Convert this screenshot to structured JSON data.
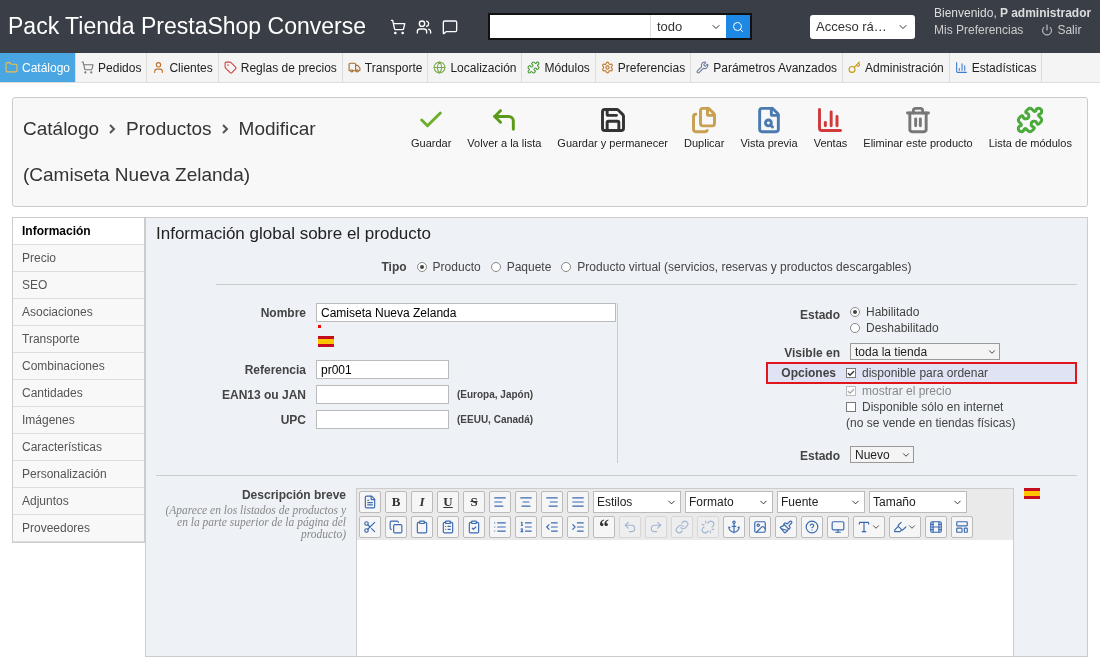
{
  "header": {
    "title": "Pack Tienda PrestaShop Converse",
    "search": {
      "scope": "todo"
    },
    "quick_access": "Acceso rá…",
    "welcome": "Bienvenido, **P administrador**",
    "preferences_link": "Mis Preferencias",
    "logout": "Salir"
  },
  "nav": [
    {
      "label": "Catálogo",
      "selected": true
    },
    {
      "label": "Pedidos",
      "selected": false
    },
    {
      "label": "Clientes",
      "selected": false
    },
    {
      "label": "Reglas de precios",
      "selected": false
    },
    {
      "label": "Transporte",
      "selected": false
    },
    {
      "label": "Localización",
      "selected": false
    },
    {
      "label": "Módulos",
      "selected": false
    },
    {
      "label": "Preferencias",
      "selected": false
    },
    {
      "label": "Parámetros Avanzados",
      "selected": false
    },
    {
      "label": "Administración",
      "selected": false
    },
    {
      "label": "Estadísticas",
      "selected": false
    }
  ],
  "breadcrumb": [
    "Catálogo",
    "Productos",
    "Modificar"
  ],
  "page_subtitle": "(Camiseta Nueva Zelanda)",
  "actions": [
    "Guardar",
    "Volver a la lista",
    "Guardar y permanecer",
    "Duplicar",
    "Vista previa",
    "Ventas",
    "Eliminar este producto",
    "Lista de módulos"
  ],
  "side_tabs": [
    {
      "label": "Información",
      "selected": true
    },
    {
      "label": "Precio",
      "selected": false
    },
    {
      "label": "SEO",
      "selected": false
    },
    {
      "label": "Asociaciones",
      "selected": false
    },
    {
      "label": "Transporte",
      "selected": false
    },
    {
      "label": "Combinaciones",
      "selected": false
    },
    {
      "label": "Cantidades",
      "selected": false
    },
    {
      "label": "Imágenes",
      "selected": false
    },
    {
      "label": "Características",
      "selected": false
    },
    {
      "label": "Personalización",
      "selected": false
    },
    {
      "label": "Adjuntos",
      "selected": false
    },
    {
      "label": "Proveedores",
      "selected": false
    }
  ],
  "panel_title": "Información global sobre el producto",
  "type": {
    "label": "Tipo",
    "options": [
      {
        "label": "Producto",
        "selected": true
      },
      {
        "label": "Paquete",
        "selected": false
      },
      {
        "label": "Producto virtual (servicios, reservas y productos descargables)",
        "selected": false
      }
    ]
  },
  "fields": [
    {
      "label": "Nombre",
      "value": "Camiseta Nueva Zelanda",
      "kind": "wide",
      "required": true,
      "flag": true
    },
    {
      "label": "Referencia",
      "value": "pr001",
      "kind": "short"
    },
    {
      "label": "EAN13 ou JAN",
      "kind": "short",
      "note": "(Europa, Japón)"
    },
    {
      "label": "UPC",
      "kind": "short",
      "note": "(EEUU, Canadá)"
    }
  ],
  "status": {
    "label": "Estado",
    "options": [
      {
        "label": "Habilitado",
        "selected": true
      },
      {
        "label": "Deshabilitado",
        "selected": false
      }
    ]
  },
  "visibility": {
    "label": "Visible en",
    "value": "toda la tienda"
  },
  "options": {
    "label": "Opciones",
    "highlighted": true,
    "items": [
      {
        "label": "disponible para ordenar",
        "checked": true,
        "disabled": false
      },
      {
        "label": "mostrar el precio",
        "checked": true,
        "disabled": true
      },
      {
        "label": "Disponible sólo en internet",
        "checked": false,
        "disabled": false
      }
    ],
    "note": "(no se vende en tiendas físicas)"
  },
  "condition": {
    "label": "Estado",
    "value": "Nuevo"
  },
  "short_description": {
    "label": "Descripción breve",
    "hint": "(Aparece en los listados de productos y en la parte superior de la página del producto)",
    "toolbar": [
      [
        {
          "kind": "button",
          "disabled": false
        },
        {
          "kind": "text",
          "label": "B"
        },
        {
          "kind": "text",
          "label": "I"
        },
        {
          "kind": "text",
          "label": "U"
        },
        {
          "kind": "text",
          "label": "S"
        },
        {
          "kind": "button",
          "disabled": false
        },
        {
          "kind": "button",
          "disabled": false
        },
        {
          "kind": "button",
          "disabled": false
        },
        {
          "kind": "button",
          "disabled": false
        },
        {
          "kind": "dropdown",
          "label": "Estilos"
        },
        {
          "kind": "dropdown",
          "label": "Formato"
        },
        {
          "kind": "dropdown",
          "label": "Fuente"
        },
        {
          "kind": "dropdown",
          "label": "Tamaño"
        }
      ],
      [
        {
          "kind": "button",
          "disabled": false
        },
        {
          "kind": "button",
          "disabled": false
        },
        {
          "kind": "button",
          "disabled": false
        },
        {
          "kind": "button",
          "disabled": false
        },
        {
          "kind": "button",
          "disabled": false
        },
        {
          "kind": "button",
          "disabled": false
        },
        {
          "kind": "button",
          "disabled": false
        },
        {
          "kind": "button",
          "disabled": false
        },
        {
          "kind": "button",
          "disabled": false
        },
        {
          "kind": "text",
          "label": "“"
        },
        {
          "kind": "button",
          "disabled": true
        },
        {
          "kind": "button",
          "disabled": true
        },
        {
          "kind": "button",
          "disabled": true
        },
        {
          "kind": "button",
          "disabled": true
        },
        {
          "kind": "button",
          "disabled": false
        },
        {
          "kind": "button",
          "disabled": false
        },
        {
          "kind": "button",
          "disabled": false
        },
        {
          "kind": "button",
          "disabled": false
        },
        {
          "kind": "button",
          "disabled": false
        },
        {
          "kind": "split",
          "disabled": false
        },
        {
          "kind": "split",
          "disabled": false
        },
        {
          "kind": "button",
          "disabled": false
        },
        {
          "kind": "button",
          "disabled": false
        }
      ]
    ]
  }
}
